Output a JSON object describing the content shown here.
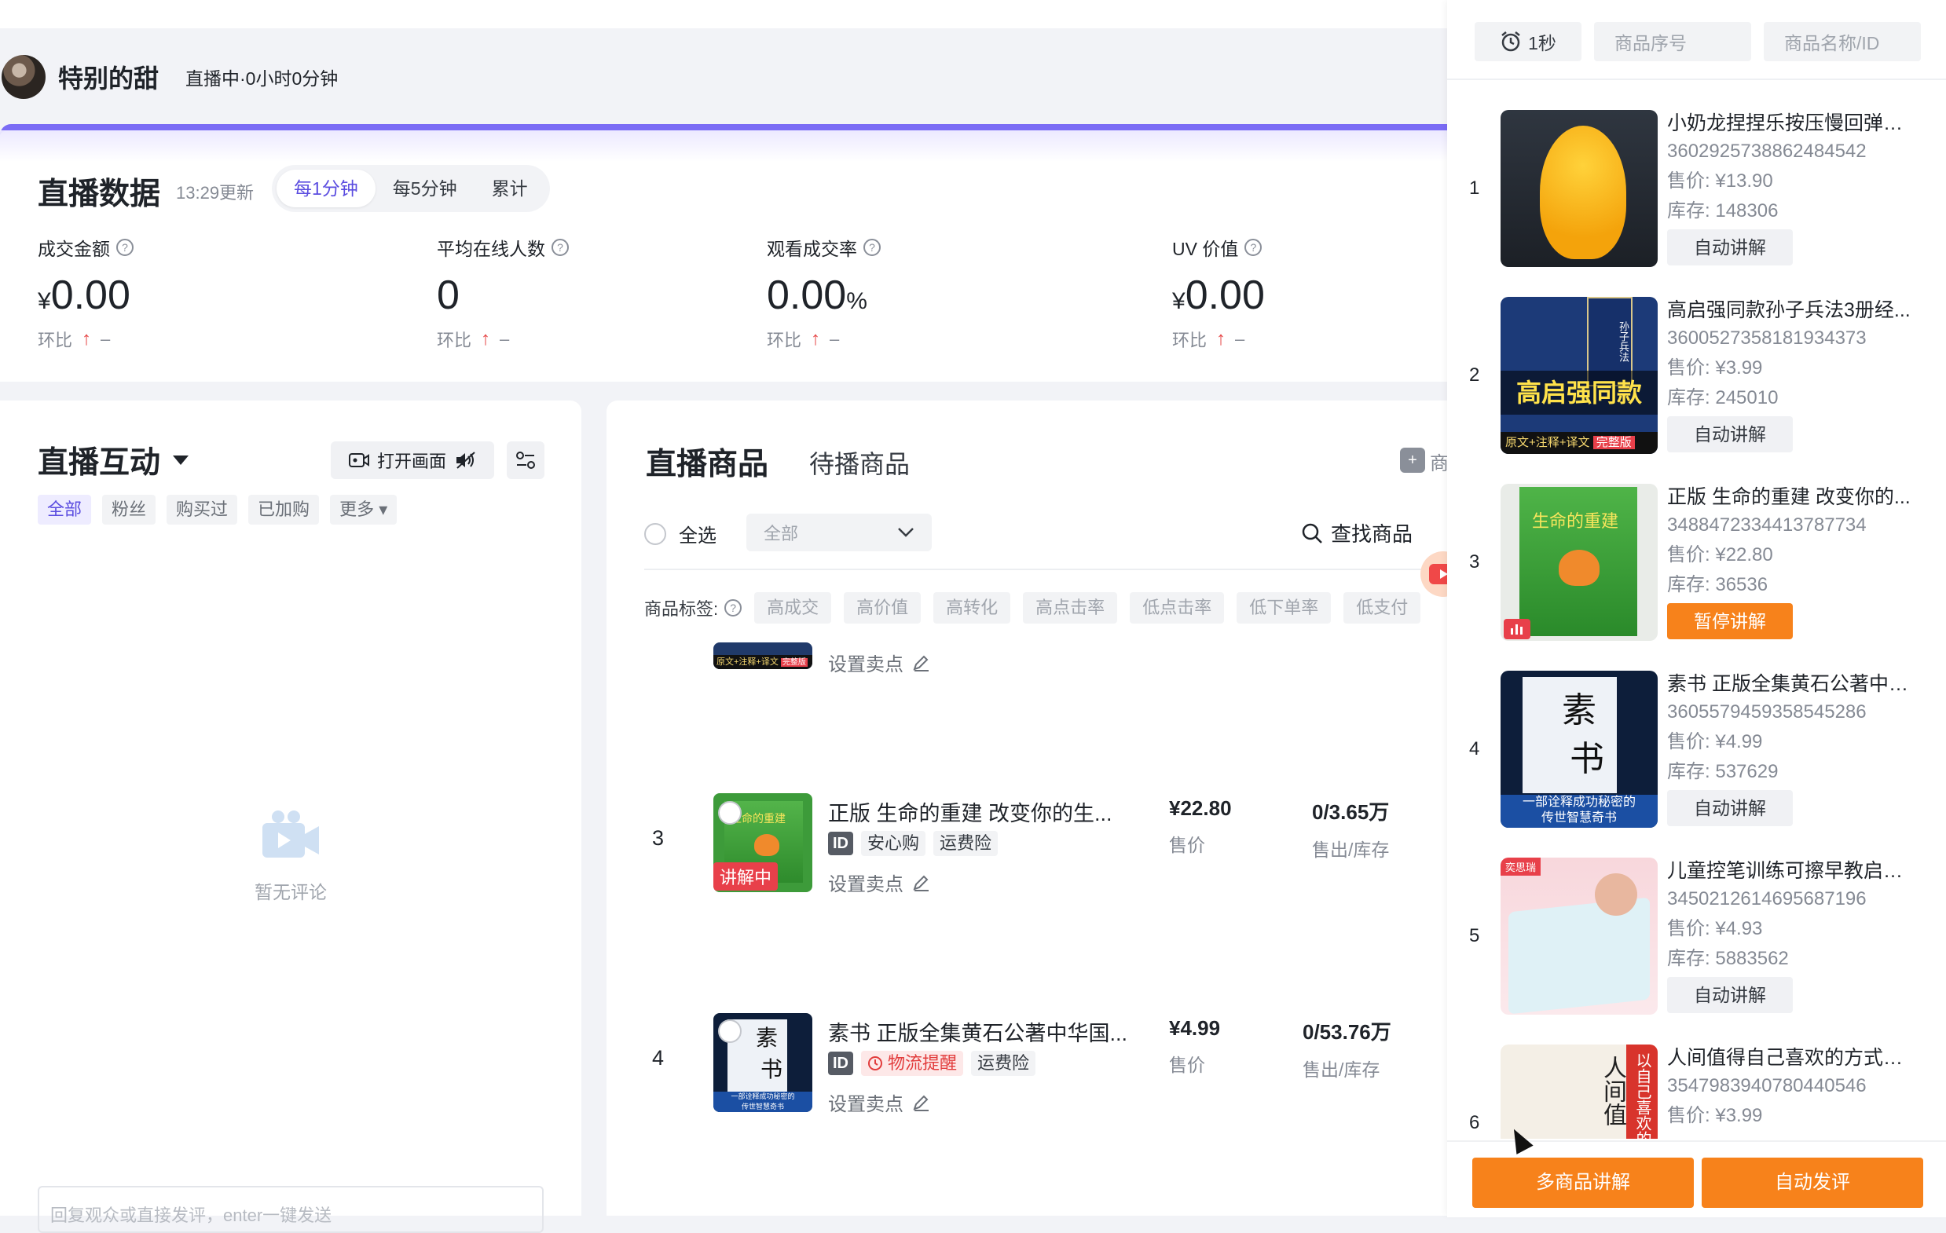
{
  "header": {
    "anchor_name": "特别的甜",
    "live_status": "直播中·0小时0分钟"
  },
  "live_data": {
    "title": "直播数据",
    "updated": "13:29更新",
    "tabs": [
      "每1分钟",
      "每5分钟",
      "累计"
    ],
    "active_tab": "每1分钟",
    "metrics": [
      {
        "label": "成交金额",
        "prefix": "¥",
        "value": "0.00",
        "suffix": "",
        "compare_label": "环比",
        "compare_value": "–"
      },
      {
        "label": "平均在线人数",
        "prefix": "",
        "value": "0",
        "suffix": "",
        "compare_label": "环比",
        "compare_value": "–"
      },
      {
        "label": "观看成交率",
        "prefix": "",
        "value": "0.00",
        "suffix": "%",
        "compare_label": "环比",
        "compare_value": "–"
      },
      {
        "label": "UV 价值",
        "prefix": "¥",
        "value": "0.00",
        "suffix": "",
        "compare_label": "环比",
        "compare_value": "–"
      }
    ]
  },
  "interaction": {
    "title": "直播互动",
    "open_screen_label": "打开画面",
    "filters": [
      "全部",
      "粉丝",
      "购买过",
      "已加购",
      "更多"
    ],
    "active_filter": "全部",
    "empty_text": "暂无评论",
    "reply_placeholder": "回复观众或直接发评，enter一键发送"
  },
  "products": {
    "title": "直播商品",
    "tab2": "待播商品",
    "right_text": "商",
    "select_all": "全选",
    "dropdown_value": "全部",
    "find_label": "查找商品",
    "tag_label": "商品标签:",
    "tags": [
      "高成交",
      "高价值",
      "高转化",
      "高点击率",
      "低点击率",
      "低下单率",
      "低支付"
    ],
    "set_sell_label": "设置卖点",
    "price_label": "售价",
    "sold_label": "售出/库存",
    "rows": [
      {
        "num": "3",
        "name": "正版 生命的重建 改变你的生...",
        "badges": [
          "ID",
          "安心购",
          "运费险"
        ],
        "price": "¥22.80",
        "sold_stock": "0/3.65万",
        "live_badge": "讲解中"
      },
      {
        "num": "4",
        "name": "素书 正版全集黄石公著中华国...",
        "badges": [
          "ID",
          "物流提醒",
          "运费险"
        ],
        "price": "¥4.99",
        "sold_stock": "0/53.76万",
        "live_badge": ""
      }
    ]
  },
  "right_panel": {
    "timer": "1秒",
    "search_seq_placeholder": "商品序号",
    "search_name_placeholder": "商品名称/ID",
    "price_prefix": "售价: ",
    "stock_prefix": "库存: ",
    "items": [
      {
        "num": "1",
        "name": "小奶龙捏捏乐按压慢回弹解...",
        "id": "3602925738862484542",
        "price": "¥13.90",
        "stock": "148306",
        "button": "自动讲解",
        "active": false
      },
      {
        "num": "2",
        "name": "高启强同款孙子兵法3册经...",
        "id": "3600527358181934373",
        "price": "¥3.99",
        "stock": "245010",
        "button": "自动讲解",
        "active": false
      },
      {
        "num": "3",
        "name": "正版 生命的重建 改变你的...",
        "id": "3488472334413787734",
        "price": "¥22.80",
        "stock": "36536",
        "button": "暂停讲解",
        "active": true
      },
      {
        "num": "4",
        "name": "素书 正版全集黄石公著中华...",
        "id": "3605579459358545286",
        "price": "¥4.99",
        "stock": "537629",
        "button": "自动讲解",
        "active": false
      },
      {
        "num": "5",
        "name": "儿童控笔训练可擦早教启蒙...",
        "id": "3450212614695687196",
        "price": "¥4.93",
        "stock": "5883562",
        "button": "自动讲解",
        "active": false
      },
      {
        "num": "6",
        "name": "人间值得自己喜欢的方式过...",
        "id": "3547983940780440546",
        "price": "¥3.99",
        "stock": "",
        "button": "",
        "active": false
      }
    ],
    "thumb_texts": {
      "item2_big": "高启强同款",
      "item2_small": "原文+注释+译文",
      "item2_corner": "完整版",
      "item2_spine": "孙子兵法",
      "item3_cover": "生命的重建",
      "item4_big1": "素",
      "item4_big2": "书",
      "item4_bottom1": "一部诠释成功秘密的",
      "item4_bottom2": "传世智慧奇书",
      "item5_corner": "奕思瑞",
      "item6_big": "人间值",
      "item6_side": "以自己喜欢的方式过"
    },
    "bottom_buttons": [
      "多商品讲解",
      "自动发评"
    ]
  },
  "colors": {
    "accent": "#5b4de0",
    "orange": "#f7821b",
    "up_red": "#e64545"
  }
}
